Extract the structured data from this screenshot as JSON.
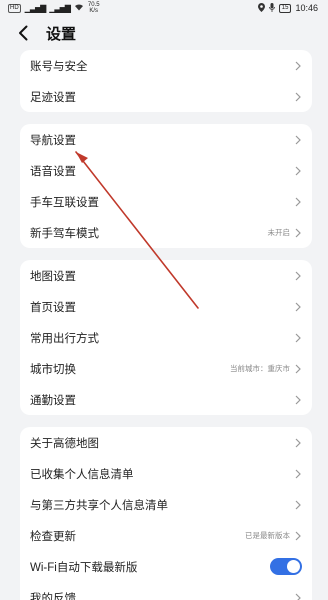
{
  "status_bar": {
    "chip": "HD",
    "speed": "70.5\nK/s",
    "battery": "15",
    "time": "10:46"
  },
  "header": {
    "title": "设置"
  },
  "groups": [
    {
      "items": [
        {
          "label": "账号与安全",
          "value": ""
        },
        {
          "label": "足迹设置",
          "value": ""
        }
      ]
    },
    {
      "items": [
        {
          "label": "导航设置",
          "value": ""
        },
        {
          "label": "语音设置",
          "value": ""
        },
        {
          "label": "手车互联设置",
          "value": ""
        },
        {
          "label": "新手驾车模式",
          "value": "未开启"
        }
      ]
    },
    {
      "items": [
        {
          "label": "地图设置",
          "value": ""
        },
        {
          "label": "首页设置",
          "value": ""
        },
        {
          "label": "常用出行方式",
          "value": ""
        },
        {
          "label": "城市切换",
          "value": "当前城市：重庆市"
        },
        {
          "label": "通勤设置",
          "value": ""
        }
      ]
    },
    {
      "items": [
        {
          "label": "关于高德地图",
          "value": ""
        },
        {
          "label": "已收集个人信息清单",
          "value": ""
        },
        {
          "label": "与第三方共享个人信息清单",
          "value": ""
        },
        {
          "label": "检查更新",
          "value": "已是最新版本"
        },
        {
          "label": "Wi-Fi自动下载最新版",
          "value": "",
          "toggle": true,
          "toggle_on": true
        },
        {
          "label": "我的反馈",
          "value": ""
        }
      ]
    }
  ],
  "colors": {
    "background": "#f2f3f5",
    "card": "#ffffff",
    "toggle_on": "#3370e4",
    "annotation_arrow": "#c0392b"
  }
}
